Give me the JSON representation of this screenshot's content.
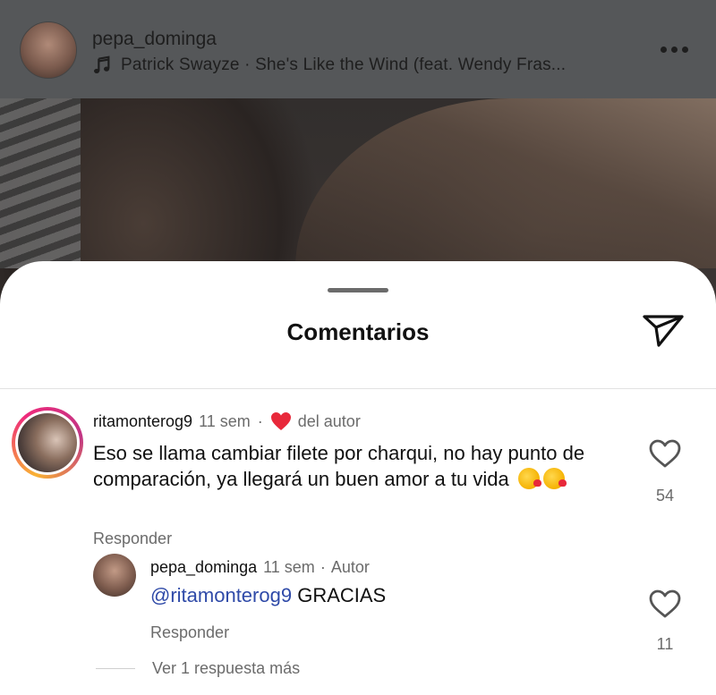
{
  "post": {
    "username": "pepa_dominga",
    "song": "Patrick Swayze · She's Like the Wind (feat. Wendy Fras..."
  },
  "sheet": {
    "title": "Comentarios"
  },
  "comments": [
    {
      "username": "ritamonterog9",
      "time": "11 sem",
      "author_like_label": "del autor",
      "text": "Eso se llama cambiar filete por charqui, no hay punto de comparación, ya llegará un buen amor a tu vida",
      "reply_label": "Responder",
      "likes": "54",
      "replies": [
        {
          "username": "pepa_dominga",
          "time": "11 sem",
          "author_badge": "Autor",
          "mention": "@ritamonterog9",
          "text": "GRACIAS",
          "reply_label": "Responder",
          "likes": "11"
        }
      ],
      "more_replies_label": "Ver 1 respuesta más"
    }
  ],
  "colors": {
    "accent_heart": "#e8283a",
    "mention": "#2f4aa8"
  },
  "icons": [
    "music-note-icon",
    "more-options-icon",
    "share-send-icon",
    "heart-filled-icon",
    "heart-outline-icon",
    "kiss-emoji-icon"
  ]
}
